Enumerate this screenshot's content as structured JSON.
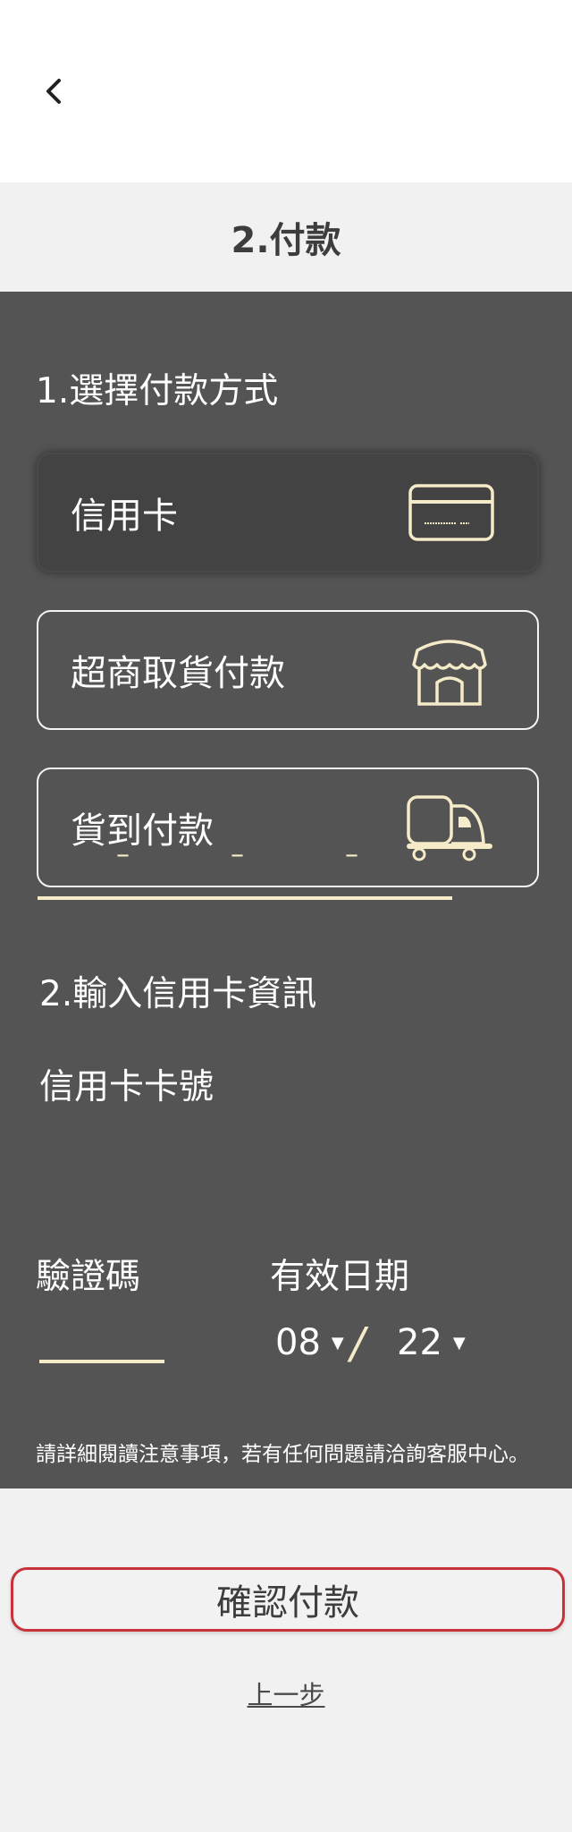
{
  "header": {
    "back_icon": "chevron-left-icon",
    "title": "2.付款"
  },
  "payment_method": {
    "section_title": "1.選擇付款方式",
    "options": [
      {
        "label": "信用卡",
        "icon": "credit-card-icon",
        "selected": true
      },
      {
        "label": "超商取貨付款",
        "icon": "store-icon",
        "selected": false
      },
      {
        "label": "貨到付款",
        "icon": "delivery-truck-icon",
        "selected": false
      }
    ]
  },
  "card_info": {
    "section_title": "2.輸入信用卡資訊",
    "card_number_label": "信用卡卡號",
    "card_number_separator": "–",
    "cvv_label": "驗證碼",
    "expiry_label": "有效日期",
    "expiry_month": "08",
    "expiry_year": "22",
    "expiry_separator": "/"
  },
  "notice": "請詳細閱讀注意事項，若有任何問題請洽詢客服中心。",
  "actions": {
    "confirm_label": "確認付款",
    "previous_label": "上一步"
  },
  "colors": {
    "panel_bg": "#545454",
    "accent_cream": "#f6ebc9",
    "confirm_border": "#c7323b",
    "page_bg": "#f1f1f1"
  }
}
